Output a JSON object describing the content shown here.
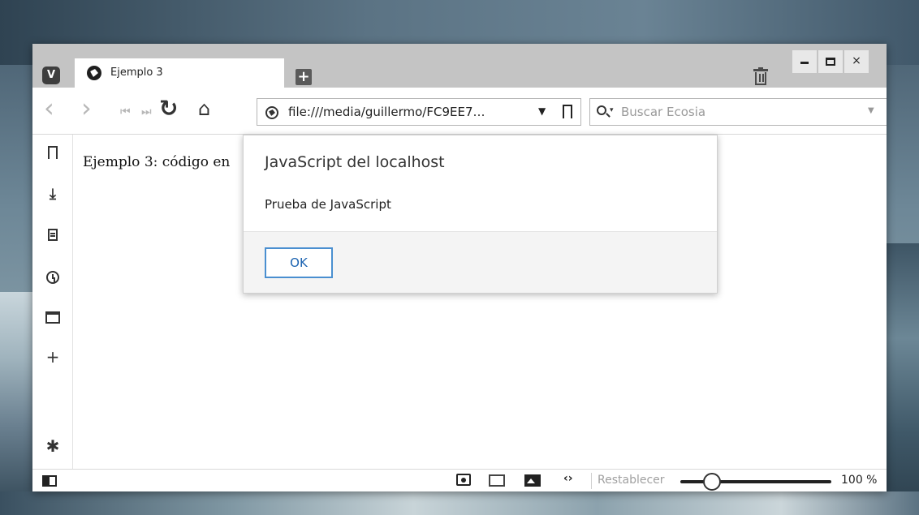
{
  "browser": {
    "logo": "V",
    "tab": {
      "title": "Ejemplo 3"
    },
    "new_tab": "+",
    "window_controls": {
      "minimize": "",
      "maximize": "",
      "close": "×"
    }
  },
  "navbar": {
    "back": "‹",
    "forward": "›",
    "rewind": "⏮",
    "fast_forward": "⏭",
    "reload": "↻",
    "home": "⌂",
    "url": "file:///media/guillermo/FC9EE7…",
    "url_dropdown": "▼",
    "search_caret": "▾",
    "search_placeholder": "Buscar Ecosia",
    "search_dropdown": "▼"
  },
  "sidepanel": {
    "download": "⤓",
    "add": "+",
    "settings": "✱"
  },
  "page": {
    "text": "Ejemplo 3: código en"
  },
  "dialog": {
    "title": "JavaScript del localhost",
    "message": "Prueba de JavaScript",
    "ok_label": "OK"
  },
  "statusbar": {
    "code": "‹›",
    "reset_label": "Restablecer",
    "zoom_level": "100 %",
    "zoom_value": 0.2
  }
}
